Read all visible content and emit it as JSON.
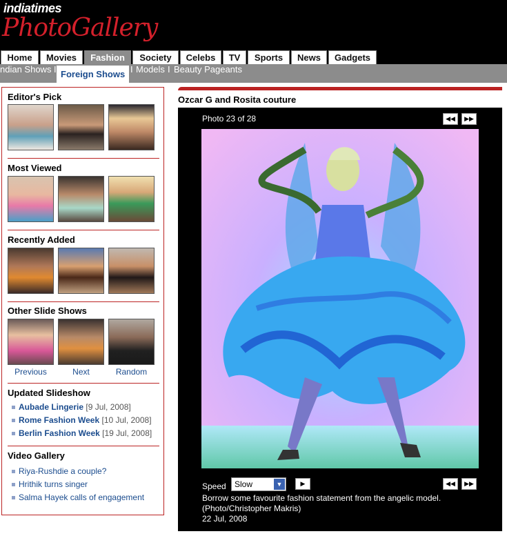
{
  "header": {
    "logo_top": "indiatimes",
    "logo_bottom": "PhotoGallery"
  },
  "tabs": [
    {
      "label": "Home"
    },
    {
      "label": "Movies"
    },
    {
      "label": "Fashion",
      "active": true
    },
    {
      "label": "Society"
    },
    {
      "label": "Celebs"
    },
    {
      "label": "TV"
    },
    {
      "label": "Sports"
    },
    {
      "label": "News"
    },
    {
      "label": "Gadgets"
    }
  ],
  "subnav": {
    "items": [
      {
        "label": "ndian Shows"
      },
      {
        "label": "Foreign Shows",
        "active": true
      },
      {
        "label": "Models"
      },
      {
        "label": "Beauty Pageants"
      }
    ],
    "separator": "I"
  },
  "sidebar": {
    "editors_pick": "Editor's Pick",
    "most_viewed": "Most Viewed",
    "recently_added": "Recently Added",
    "other_slide_shows": "Other Slide Shows",
    "nav": {
      "previous": "Previous",
      "next": "Next",
      "random": "Random"
    },
    "updated_slideshow": {
      "title": "Updated Slideshow",
      "items": [
        {
          "title": "Aubade Lingerie",
          "date": "[9 Jul, 2008]"
        },
        {
          "title": "Rome Fashion Week",
          "date": "[10 Jul, 2008]"
        },
        {
          "title": "Berlin Fashion Week",
          "date": "[19 Jul, 2008]"
        }
      ]
    },
    "video_gallery": {
      "title": "Video Gallery",
      "items": [
        {
          "title": "Riya-Rushdie a couple?"
        },
        {
          "title": "Hrithik turns singer"
        },
        {
          "title": "Salma Hayek calls of engagement"
        }
      ]
    }
  },
  "main": {
    "title": "Ozcar G and Rosita couture",
    "photo_counter": "Photo 23 of 28",
    "speed_label": "Speed",
    "speed_value": "Slow",
    "caption": "Borrow some favourite fashion statement from the angelic model. (Photo/Christopher Makris)",
    "date": "22 Jul, 2008"
  },
  "colors": {
    "accent_red": "#b22222",
    "link_blue": "#1b4c8e",
    "nav_grey": "#8c8c8c"
  }
}
